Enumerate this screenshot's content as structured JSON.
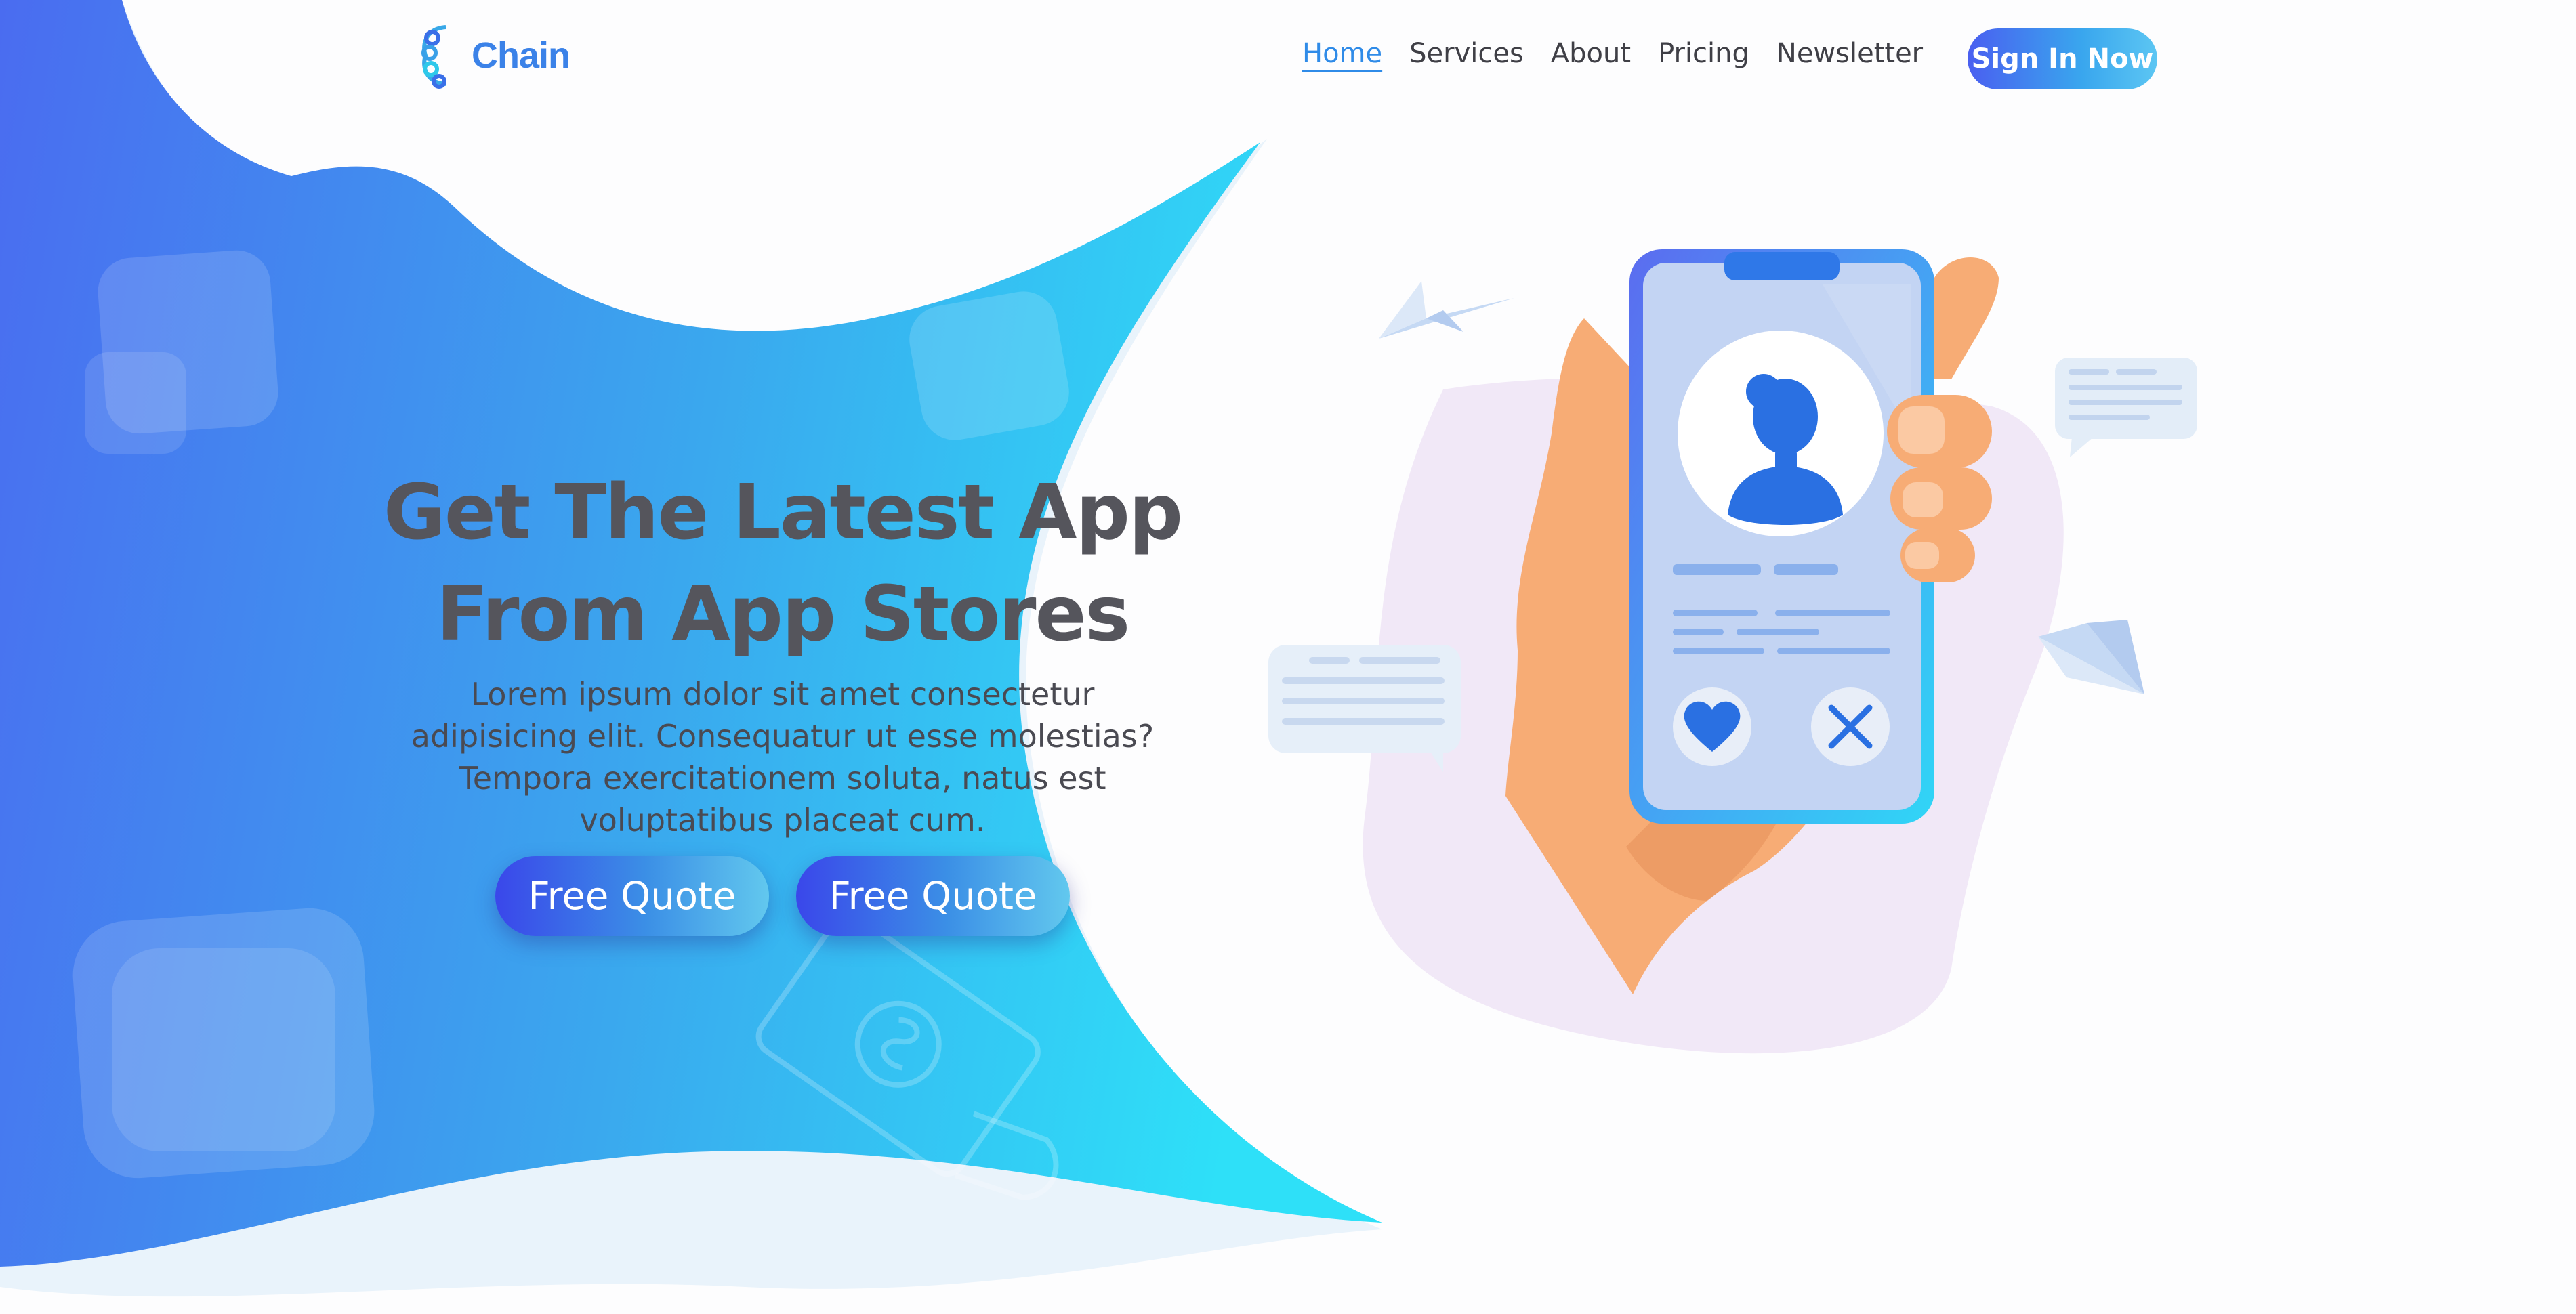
{
  "brand": {
    "name": "Chain",
    "logo_icon": "chain-link-icon",
    "color": "#3b82e8"
  },
  "nav": {
    "items": [
      {
        "label": "Home",
        "active": true
      },
      {
        "label": "Services",
        "active": false
      },
      {
        "label": "About",
        "active": false
      },
      {
        "label": "Pricing",
        "active": false
      },
      {
        "label": "Newsletter",
        "active": false
      }
    ],
    "signin_label": "Sign In Now"
  },
  "hero": {
    "title_line1": "Get The Latest App",
    "title_line2": "From App Stores",
    "description": "Lorem ipsum dolor sit amet consectetur adipisicing elit. Consequatur ut esse molestias? Tempora exercitationem soluta, natus est voluptatibus placeat cum.",
    "buttons": [
      "Free Quote",
      "Free Quote"
    ]
  },
  "illustration": {
    "icons": [
      "smartphone-icon",
      "user-avatar-icon",
      "heart-icon",
      "close-icon",
      "paper-plane-icon",
      "chat-bubble-icon",
      "money-hand-icon"
    ]
  },
  "colors": {
    "accent_blue": "#2f8be8",
    "gradient_start": "#4a6cf0",
    "gradient_end": "#2ee0f8",
    "text_dark": "#55555c"
  }
}
